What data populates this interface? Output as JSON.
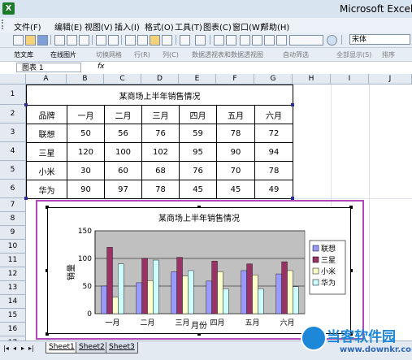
{
  "window": {
    "title": "Microsoft Excel - ",
    "app_icon": "X"
  },
  "menu": [
    "文件(F)",
    "编辑(E)",
    "视图(V)",
    "插入(I)",
    "格式(O)",
    "工具(T)",
    "图表(C)",
    "窗口(W)",
    "帮助(H)"
  ],
  "toolbar": {
    "font_name": "宋体"
  },
  "toolbar2": [
    "范文库",
    "在线图片",
    "切换网格",
    "行(R)",
    "列(C)",
    "数据透视表和数据透视图",
    "自动筛选",
    "全部显示(S)",
    "排序"
  ],
  "formula_bar": {
    "name_box": "图表 1",
    "fx": "fx"
  },
  "columns": [
    "A",
    "B",
    "C",
    "D",
    "E",
    "F",
    "G",
    "H",
    "I",
    "J"
  ],
  "rows": [
    "1",
    "2",
    "3",
    "4",
    "5",
    "6",
    "7",
    "8",
    "9",
    "10",
    "11",
    "12",
    "13",
    "14",
    "15",
    "16",
    "17",
    "18"
  ],
  "table": {
    "title": "某商场上半年销售情况",
    "header": [
      "品牌",
      "一月",
      "二月",
      "三月",
      "四月",
      "五月",
      "六月"
    ],
    "rows": [
      [
        "联想",
        "50",
        "56",
        "76",
        "59",
        "78",
        "72"
      ],
      [
        "三星",
        "120",
        "100",
        "102",
        "95",
        "90",
        "94"
      ],
      [
        "小米",
        "30",
        "60",
        "68",
        "76",
        "70",
        "78"
      ],
      [
        "华为",
        "90",
        "97",
        "78",
        "45",
        "45",
        "49"
      ]
    ]
  },
  "chart_data": {
    "type": "bar",
    "title": "某商场上半年销售情况",
    "xlabel": "月份",
    "ylabel": "销量",
    "categories": [
      "一月",
      "二月",
      "三月",
      "四月",
      "五月",
      "六月"
    ],
    "ylim": [
      0,
      150
    ],
    "yticks": [
      "0",
      "50",
      "100",
      "150"
    ],
    "legend_position": "right",
    "grid": true,
    "plot_background": "#c0c0c0",
    "series": [
      {
        "name": "联想",
        "values": [
          50,
          56,
          76,
          59,
          78,
          72
        ],
        "color": "#9999ff"
      },
      {
        "name": "三星",
        "values": [
          120,
          100,
          102,
          95,
          90,
          94
        ],
        "color": "#993366"
      },
      {
        "name": "小米",
        "values": [
          30,
          60,
          68,
          76,
          70,
          78
        ],
        "color": "#ffffcc"
      },
      {
        "name": "华为",
        "values": [
          90,
          97,
          78,
          45,
          45,
          49
        ],
        "color": "#ccffff"
      }
    ]
  },
  "sheets": [
    "Sheet1",
    "Sheet2",
    "Sheet3"
  ],
  "watermark": {
    "text": "当客软件园",
    "url": "www.downkr.com"
  }
}
